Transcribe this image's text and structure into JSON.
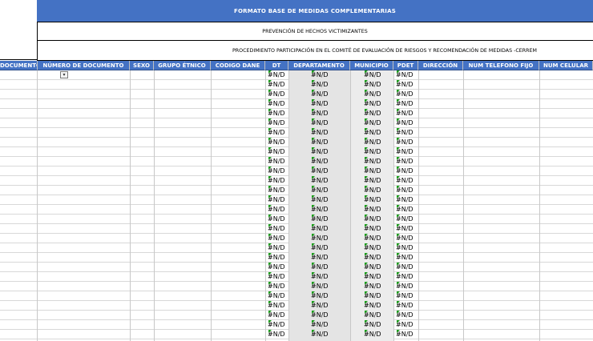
{
  "banner": {
    "title": "FORMATO BASE DE MEDIDAS COMPLEMENTARIAS",
    "subtitle": "PREVENCIÓN DE HECHOS VICTIMIZANTES",
    "procedure": "PROCEDIMIENTO PARTICIPACIÓN EN EL COMITÉ DE EVALUACIÓN DE RIESGOS Y RECOMENDACIÓN DE MEDIDAS -CERREM"
  },
  "columns": [
    "DOCUMENTO",
    "NÚMERO DE DOCUMENTO",
    "SEXO",
    "GRUPO ÉTNICO",
    "CODIGO DANE",
    "DT",
    "DEPARTAMENTO",
    "MUNICIPIO",
    "PDET",
    "DIRECCIÓN",
    "NUM TELEFONO FIJO",
    "NUM CELULAR"
  ],
  "error_value": "#N/D",
  "filter_glyph": "▾",
  "colors": {
    "header_bg": "#4472c4",
    "header_text": "#ffffff",
    "error_marker": "#1a9c1a",
    "shaded_column": "#e4e4e4"
  }
}
